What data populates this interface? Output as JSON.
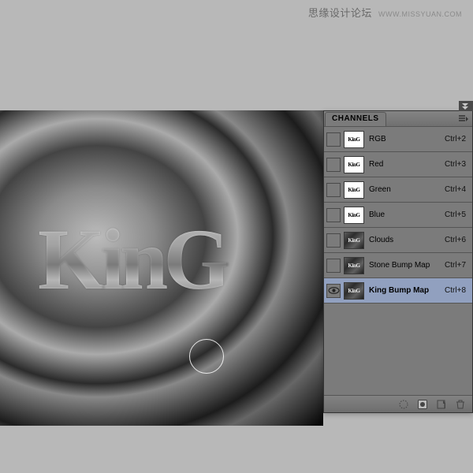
{
  "watermark": {
    "main": "思缘设计论坛",
    "sub": "WWW.MISSYUAN.COM"
  },
  "canvas": {
    "text": "KinG"
  },
  "panel": {
    "tab_label": "CHANNELS",
    "channels": [
      {
        "name": "RGB",
        "shortcut": "Ctrl+2",
        "thumb": "king-white",
        "visible": false,
        "selected": false
      },
      {
        "name": "Red",
        "shortcut": "Ctrl+3",
        "thumb": "king-white",
        "visible": false,
        "selected": false
      },
      {
        "name": "Green",
        "shortcut": "Ctrl+4",
        "thumb": "king-white",
        "visible": false,
        "selected": false
      },
      {
        "name": "Blue",
        "shortcut": "Ctrl+5",
        "thumb": "king-white",
        "visible": false,
        "selected": false
      },
      {
        "name": "Clouds",
        "shortcut": "Ctrl+6",
        "thumb": "dark",
        "visible": false,
        "selected": false
      },
      {
        "name": "Stone Bump Map",
        "shortcut": "Ctrl+7",
        "thumb": "dark",
        "visible": false,
        "selected": false
      },
      {
        "name": "King Bump Map",
        "shortcut": "Ctrl+8",
        "thumb": "dark",
        "visible": true,
        "selected": true
      }
    ],
    "thumb_text": "KinG"
  }
}
